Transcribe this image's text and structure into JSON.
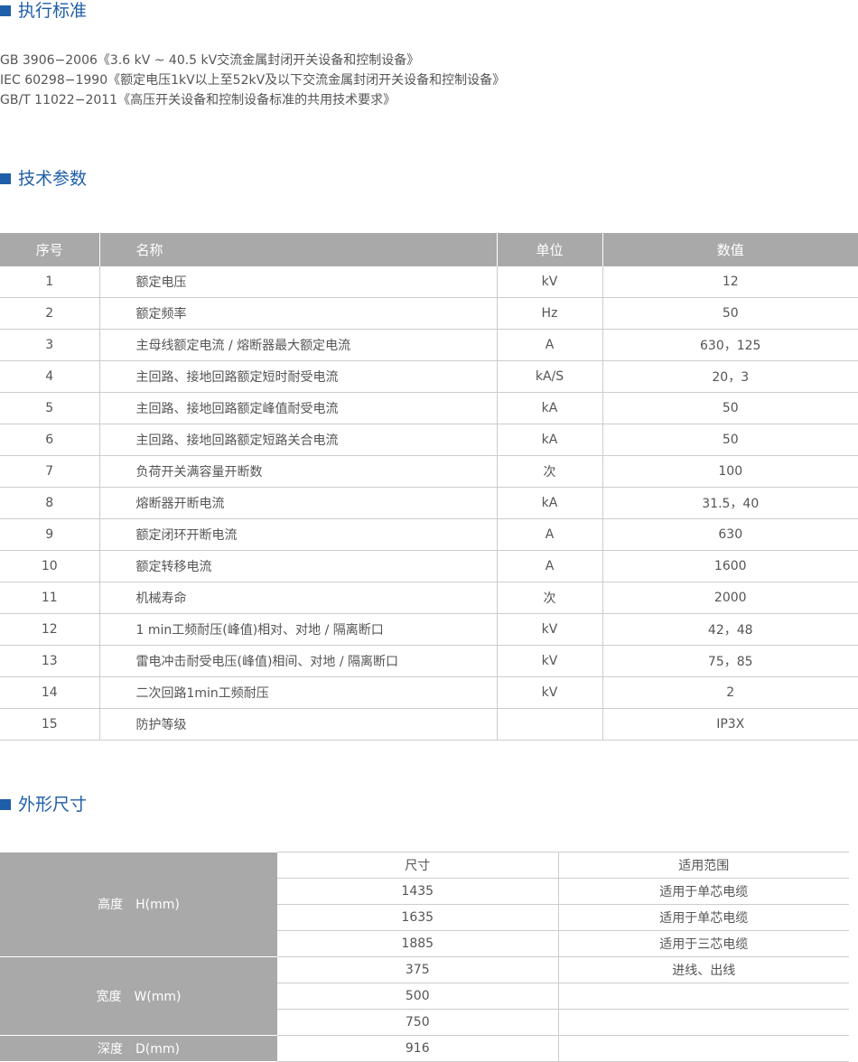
{
  "sections": {
    "standards": "执行标准",
    "params": "技术参数",
    "dims": "外形尺寸"
  },
  "standards": [
    "GB 3906−2006《3.6 kV ~ 40.5 kV交流金属封闭开关设备和控制设备》",
    "IEC 60298−1990《额定电压1kV以上至52kV及以下交流金属封闭开关设备和控制设备》",
    "GB/T 11022−2011《高压开关设备和控制设备标准的共用技术要求》"
  ],
  "params_table": {
    "headers": [
      "序号",
      "名称",
      "单位",
      "数值"
    ],
    "rows": [
      [
        "1",
        "额定电压",
        "kV",
        "12"
      ],
      [
        "2",
        "额定频率",
        "Hz",
        "50"
      ],
      [
        "3",
        "主母线额定电流 / 熔断器最大额定电流",
        "A",
        "630，125"
      ],
      [
        "4",
        "主回路、接地回路额定短时耐受电流",
        "kA/S",
        "20，3"
      ],
      [
        "5",
        "主回路、接地回路额定峰值耐受电流",
        "kA",
        "50"
      ],
      [
        "6",
        "主回路、接地回路额定短路关合电流",
        "kA",
        "50"
      ],
      [
        "7",
        "负荷开关满容量开断数",
        "次",
        "100"
      ],
      [
        "8",
        "熔断器开断电流",
        "kA",
        "31.5，40"
      ],
      [
        "9",
        "额定闭环开断电流",
        "A",
        "630"
      ],
      [
        "10",
        "额定转移电流",
        "A",
        "1600"
      ],
      [
        "11",
        "机械寿命",
        "次",
        "2000"
      ],
      [
        "12",
        "1 min工频耐压(峰值)相对、对地 / 隔离断口",
        "kV",
        "42，48"
      ],
      [
        "13",
        "雷电冲击耐受电压(峰值)相间、对地 / 隔离断口",
        "kV",
        "75，85"
      ],
      [
        "14",
        "二次回路1min工频耐压",
        "kV",
        "2"
      ],
      [
        "15",
        "防护等级",
        "",
        "IP3X"
      ]
    ]
  },
  "dims_table": {
    "headers": [
      "尺寸",
      "适用范围"
    ],
    "height_label": "高度　H(mm)",
    "width_label": "宽度　W(mm)",
    "depth_label": "深度　D(mm)",
    "height_rows": [
      [
        "1435",
        "适用于单芯电缆"
      ],
      [
        "1635",
        "适用于单芯电缆"
      ],
      [
        "1885",
        "适用于三芯电缆"
      ]
    ],
    "width_rows": [
      [
        "375",
        "进线、出线"
      ],
      [
        "500",
        ""
      ],
      [
        "750",
        ""
      ]
    ],
    "depth_rows": [
      [
        "916",
        ""
      ]
    ]
  }
}
